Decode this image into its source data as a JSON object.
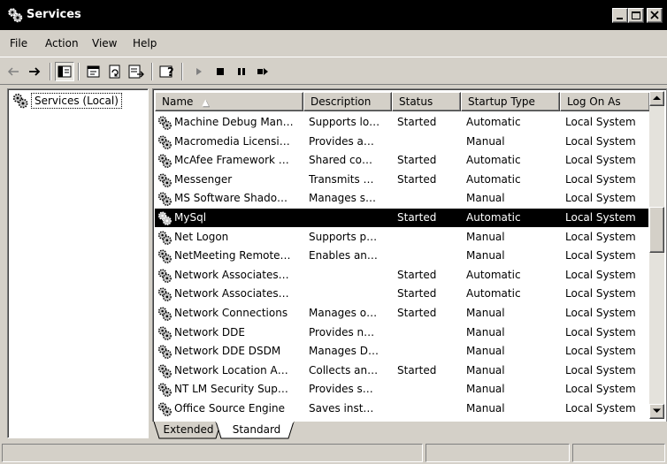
{
  "window": {
    "title": "Services"
  },
  "menu": [
    "File",
    "Action",
    "View",
    "Help"
  ],
  "toolbar": {
    "buttons": [
      "back-icon",
      "forward-icon",
      "show-hide-tree-icon",
      "properties-icon",
      "refresh-icon",
      "export-list-icon",
      "help-icon",
      "start-service-icon",
      "stop-service-icon",
      "pause-service-icon",
      "restart-service-icon"
    ]
  },
  "tree": {
    "root_label": "Services (Local)"
  },
  "list": {
    "columns": [
      "Name",
      "Description",
      "Status",
      "Startup Type",
      "Log On As"
    ],
    "sort_indicator": "▲",
    "selected_row": 5,
    "rows": [
      {
        "name": "Machine Debug Man…",
        "description": "Supports lo…",
        "status": "Started",
        "startup": "Automatic",
        "logon": "Local System"
      },
      {
        "name": "Macromedia Licensi…",
        "description": "Provides a…",
        "status": "",
        "startup": "Manual",
        "logon": "Local System"
      },
      {
        "name": "McAfee Framework …",
        "description": "Shared co…",
        "status": "Started",
        "startup": "Automatic",
        "logon": "Local System"
      },
      {
        "name": "Messenger",
        "description": "Transmits …",
        "status": "Started",
        "startup": "Automatic",
        "logon": "Local System"
      },
      {
        "name": "MS Software Shado…",
        "description": "Manages s…",
        "status": "",
        "startup": "Manual",
        "logon": "Local System"
      },
      {
        "name": "MySql",
        "description": "",
        "status": "Started",
        "startup": "Automatic",
        "logon": "Local System"
      },
      {
        "name": "Net Logon",
        "description": "Supports p…",
        "status": "",
        "startup": "Manual",
        "logon": "Local System"
      },
      {
        "name": "NetMeeting Remote…",
        "description": "Enables an…",
        "status": "",
        "startup": "Manual",
        "logon": "Local System"
      },
      {
        "name": "Network Associates…",
        "description": "",
        "status": "Started",
        "startup": "Automatic",
        "logon": "Local System"
      },
      {
        "name": "Network Associates…",
        "description": "",
        "status": "Started",
        "startup": "Automatic",
        "logon": "Local System"
      },
      {
        "name": "Network Connections",
        "description": "Manages o…",
        "status": "Started",
        "startup": "Manual",
        "logon": "Local System"
      },
      {
        "name": "Network DDE",
        "description": "Provides n…",
        "status": "",
        "startup": "Manual",
        "logon": "Local System"
      },
      {
        "name": "Network DDE DSDM",
        "description": "Manages D…",
        "status": "",
        "startup": "Manual",
        "logon": "Local System"
      },
      {
        "name": "Network Location A…",
        "description": "Collects an…",
        "status": "Started",
        "startup": "Manual",
        "logon": "Local System"
      },
      {
        "name": "NT LM Security Sup…",
        "description": "Provides s…",
        "status": "",
        "startup": "Manual",
        "logon": "Local System"
      },
      {
        "name": "Office Source Engine",
        "description": "Saves inst…",
        "status": "",
        "startup": "Manual",
        "logon": "Local System"
      }
    ]
  },
  "tabs": {
    "items": [
      "Extended",
      "Standard"
    ],
    "active": "Standard"
  },
  "colors": {
    "selection": "#000000",
    "face": "#d4d0c8",
    "window": "#ffffff"
  }
}
